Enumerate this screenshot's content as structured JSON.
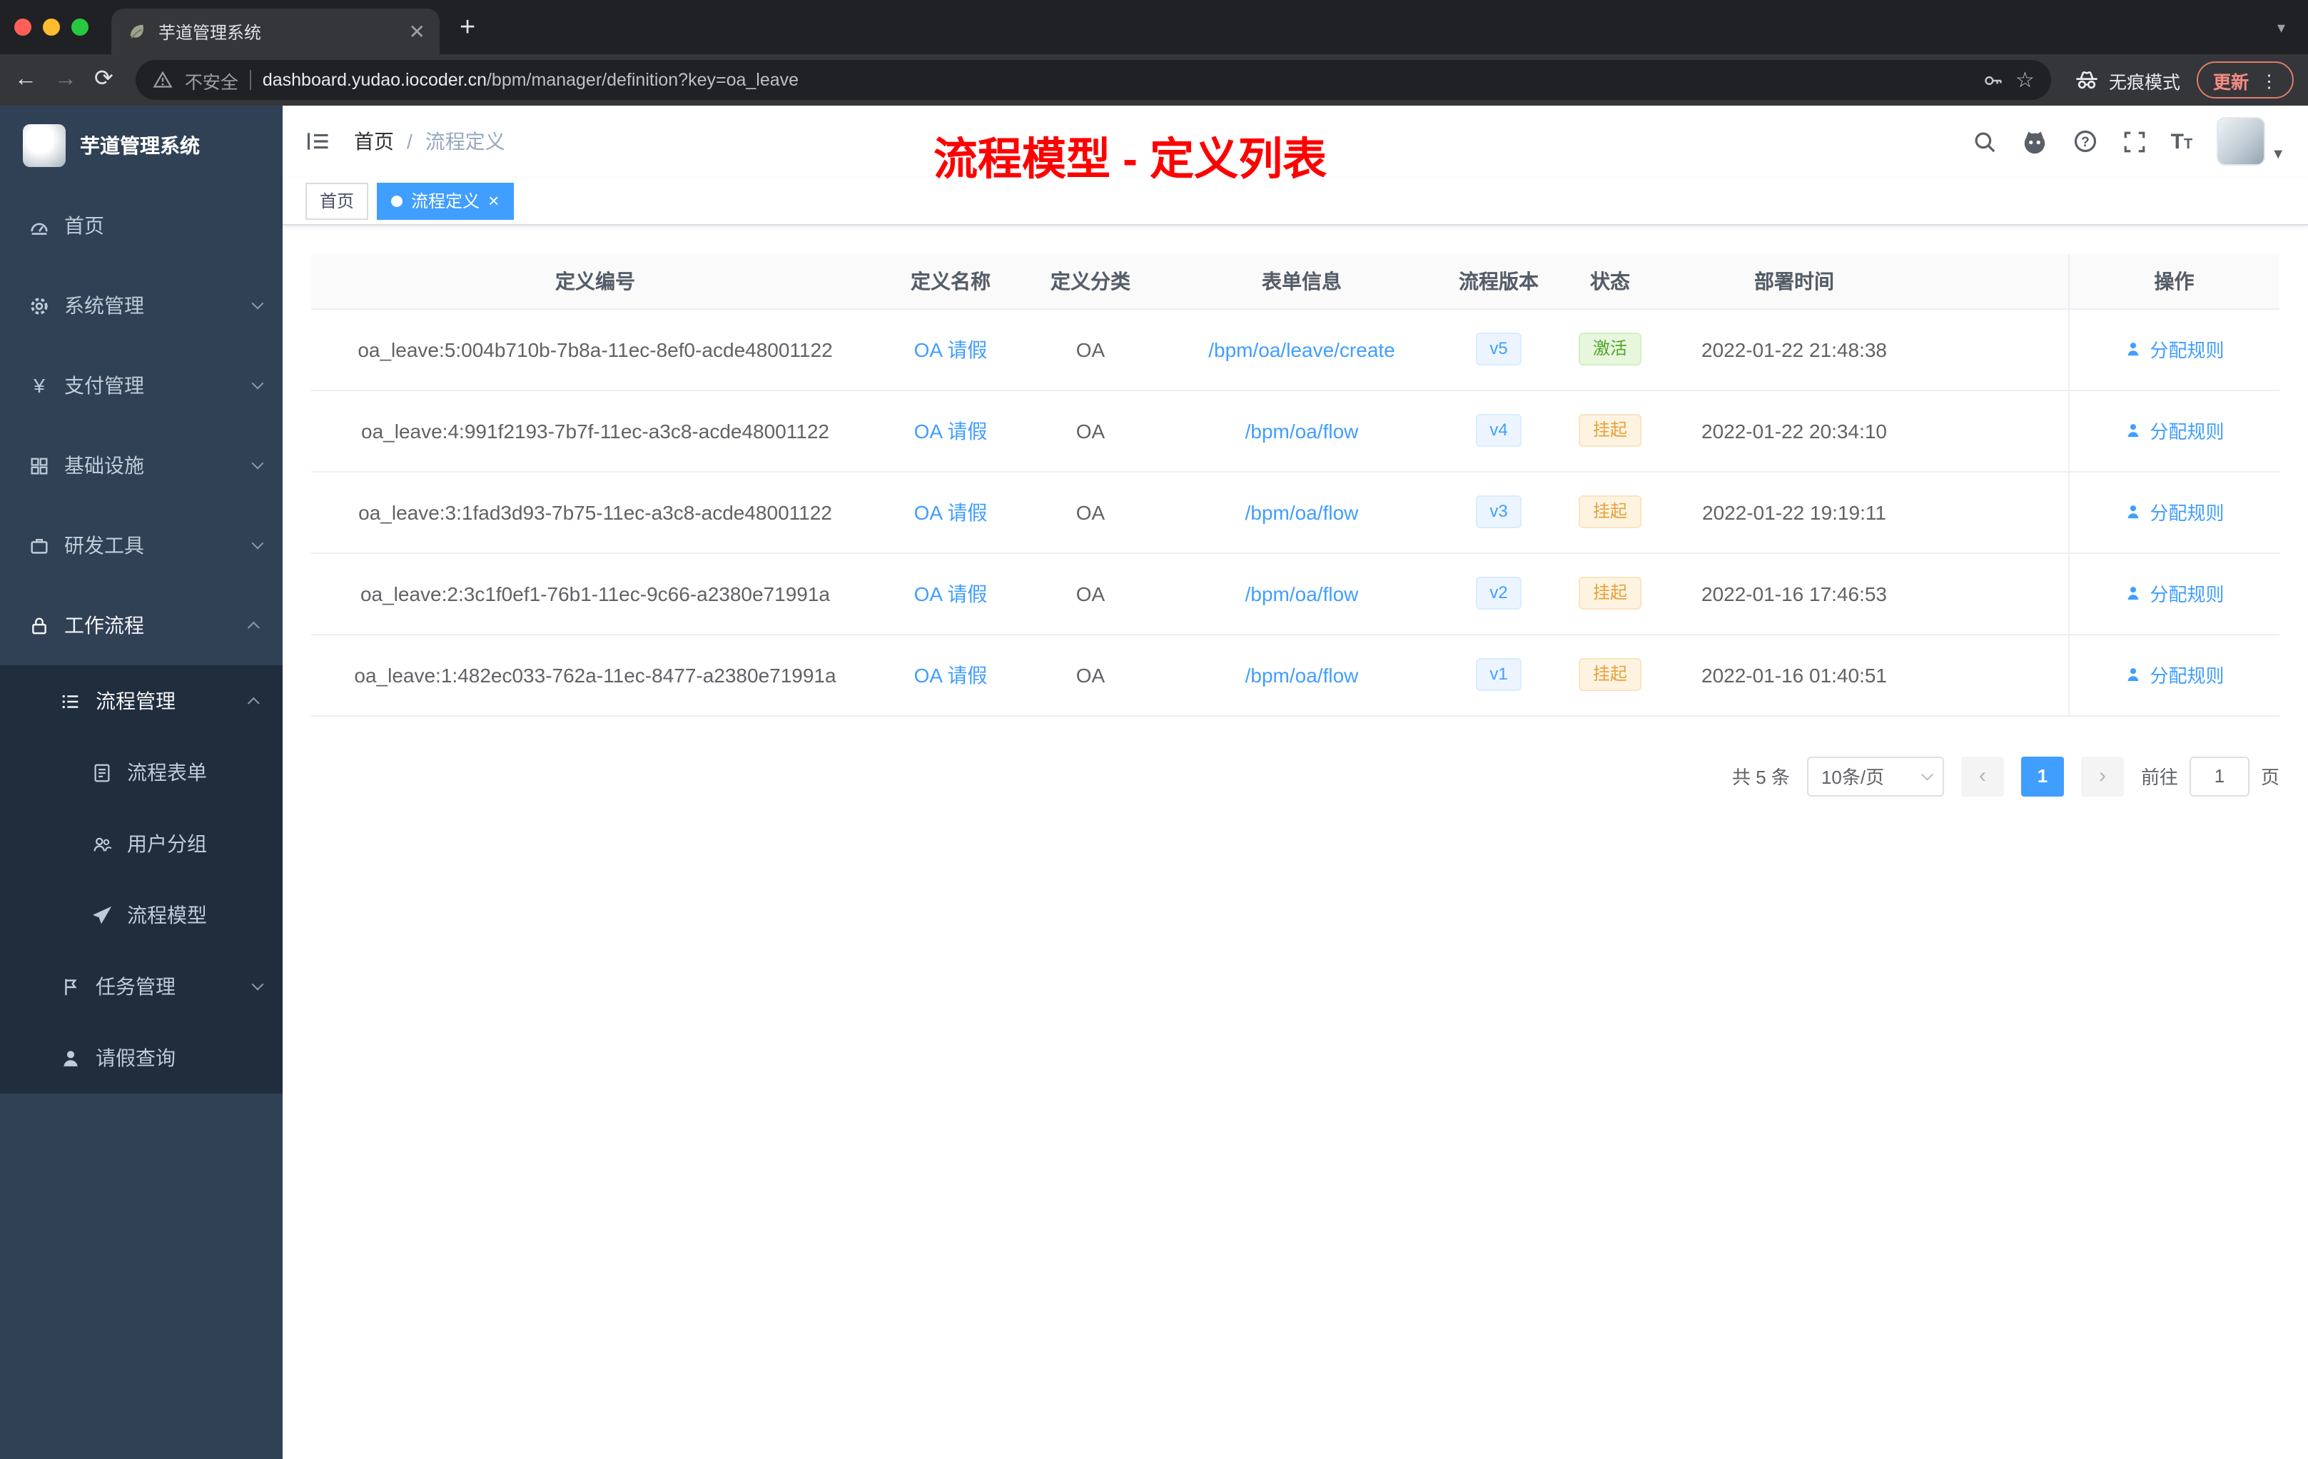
{
  "browser": {
    "tab_title": "芋道管理系统",
    "security_label": "不安全",
    "url_host": "dashboard.yudao.iocoder.cn",
    "url_path": "/bpm/manager/definition?key=oa_leave",
    "incognito_label": "无痕模式",
    "update_label": "更新"
  },
  "sidebar": {
    "logo_title": "芋道管理系统",
    "items": [
      {
        "label": "首页"
      },
      {
        "label": "系统管理"
      },
      {
        "label": "支付管理"
      },
      {
        "label": "基础设施"
      },
      {
        "label": "研发工具"
      },
      {
        "label": "工作流程"
      }
    ],
    "submenu": {
      "group_label": "流程管理",
      "group_children": [
        {
          "label": "流程表单"
        },
        {
          "label": "用户分组"
        },
        {
          "label": "流程模型"
        }
      ],
      "items": [
        {
          "label": "任务管理"
        },
        {
          "label": "请假查询"
        }
      ]
    }
  },
  "header": {
    "breadcrumb_home": "首页",
    "breadcrumb_current": "流程定义",
    "annotation": "流程模型 - 定义列表"
  },
  "tags": {
    "home": "首页",
    "current": "流程定义"
  },
  "table": {
    "columns": {
      "id": "定义编号",
      "name": "定义名称",
      "category": "定义分类",
      "form": "表单信息",
      "version": "流程版本",
      "status": "状态",
      "deploy_time": "部署时间",
      "actions": "操作"
    },
    "rows": [
      {
        "id": "oa_leave:5:004b710b-7b8a-11ec-8ef0-acde48001122",
        "name": "OA 请假",
        "category": "OA",
        "form": "/bpm/oa/leave/create",
        "version": "v5",
        "status": "激活",
        "deploy_time": "2022-01-22 21:48:38",
        "action": "分配规则"
      },
      {
        "id": "oa_leave:4:991f2193-7b7f-11ec-a3c8-acde48001122",
        "name": "OA 请假",
        "category": "OA",
        "form": "/bpm/oa/flow",
        "version": "v4",
        "status": "挂起",
        "deploy_time": "2022-01-22 20:34:10",
        "action": "分配规则"
      },
      {
        "id": "oa_leave:3:1fad3d93-7b75-11ec-a3c8-acde48001122",
        "name": "OA 请假",
        "category": "OA",
        "form": "/bpm/oa/flow",
        "version": "v3",
        "status": "挂起",
        "deploy_time": "2022-01-22 19:19:11",
        "action": "分配规则"
      },
      {
        "id": "oa_leave:2:3c1f0ef1-76b1-11ec-9c66-a2380e71991a",
        "name": "OA 请假",
        "category": "OA",
        "form": "/bpm/oa/flow",
        "version": "v2",
        "status": "挂起",
        "deploy_time": "2022-01-16 17:46:53",
        "action": "分配规则"
      },
      {
        "id": "oa_leave:1:482ec033-762a-11ec-8477-a2380e71991a",
        "name": "OA 请假",
        "category": "OA",
        "form": "/bpm/oa/flow",
        "version": "v1",
        "status": "挂起",
        "deploy_time": "2022-01-16 01:40:51",
        "action": "分配规则"
      }
    ]
  },
  "pagination": {
    "total": "共 5 条",
    "page_size": "10条/页",
    "current_page": "1",
    "goto_label": "前往",
    "goto_value": "1",
    "goto_suffix": "页"
  },
  "colors": {
    "accent": "#409EFF",
    "success": "#67C23A",
    "warning": "#E6A23C",
    "annotation": "#FF0000",
    "sidebar_bg": "#304156",
    "submenu_bg": "#1F2D3D"
  }
}
